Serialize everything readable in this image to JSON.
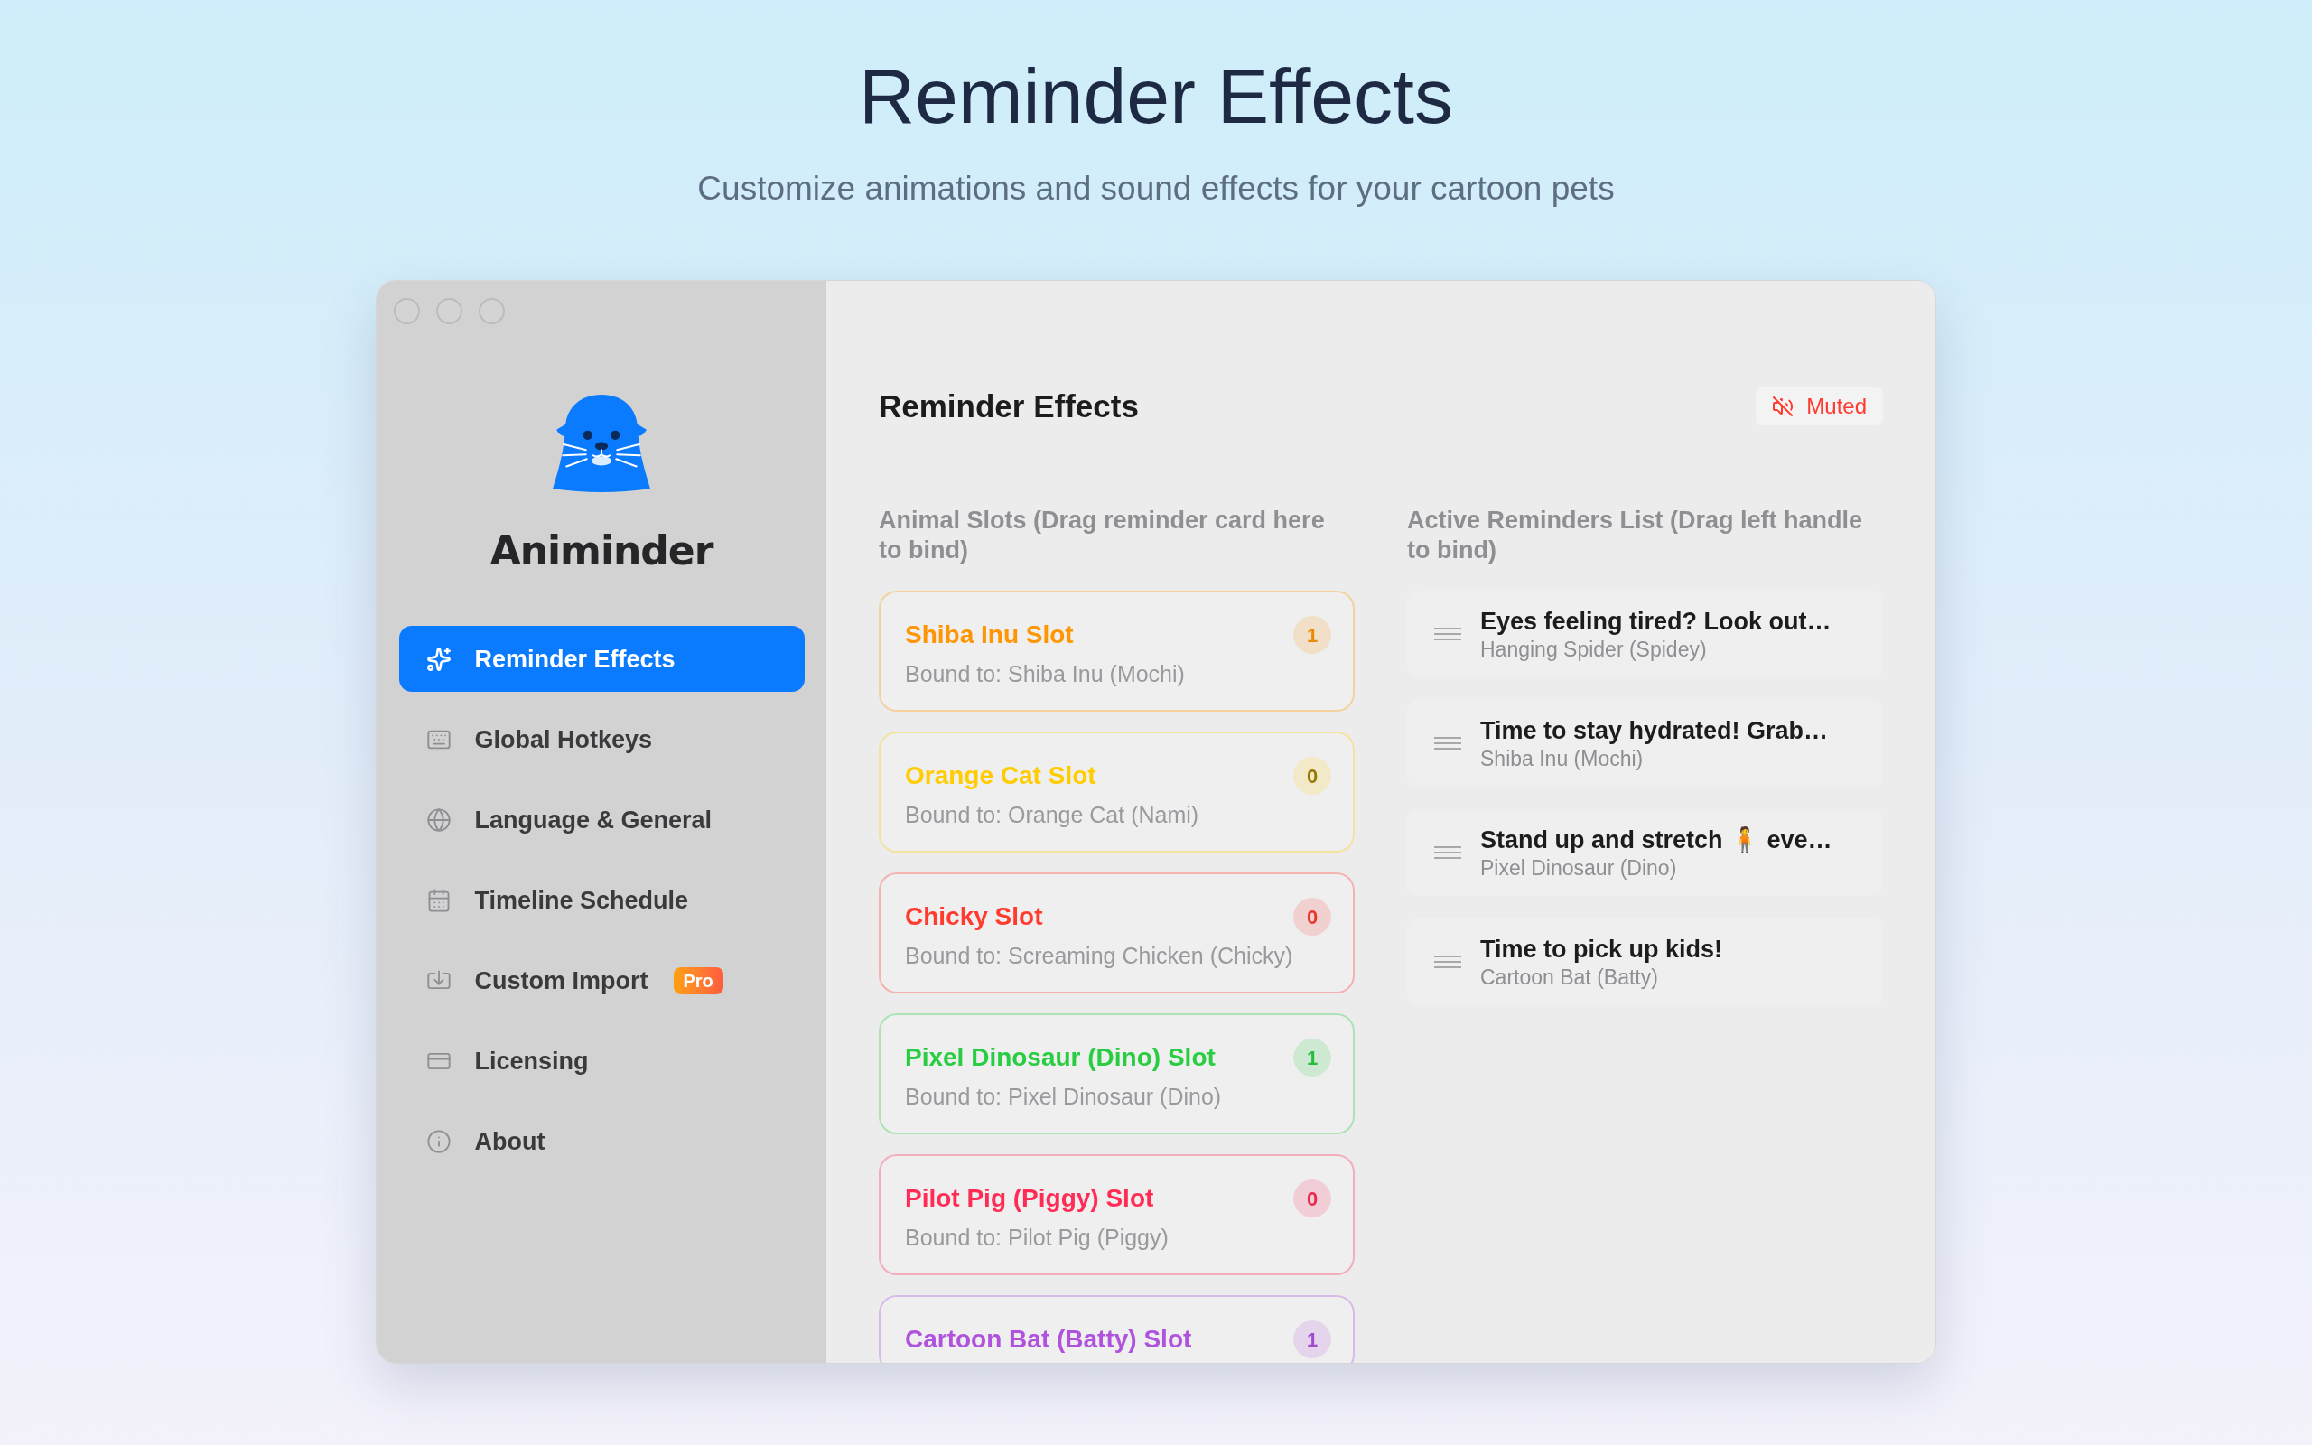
{
  "header": {
    "title": "Reminder Effects",
    "subtitle": "Customize animations and sound effects for your cartoon pets"
  },
  "sidebar": {
    "app_name": "Animinder",
    "items": [
      {
        "label": "Reminder Effects",
        "selected": true
      },
      {
        "label": "Global Hotkeys",
        "selected": false
      },
      {
        "label": "Language & General",
        "selected": false
      },
      {
        "label": "Timeline Schedule",
        "selected": false
      },
      {
        "label": "Custom Import",
        "selected": false,
        "badge": "Pro"
      },
      {
        "label": "Licensing",
        "selected": false
      },
      {
        "label": "About",
        "selected": false
      }
    ]
  },
  "main": {
    "title": "Reminder Effects",
    "sound_button": {
      "label": "Muted",
      "muted": true
    },
    "slots": {
      "heading": "Animal Slots (Drag reminder card here to bind)",
      "items": [
        {
          "name": "Shiba Inu Slot",
          "count": "1",
          "bound_to": "Bound to: Shiba Inu (Mochi)",
          "color": "#ff9500"
        },
        {
          "name": "Orange Cat Slot",
          "count": "0",
          "bound_to": "Bound to: Orange Cat (Nami)",
          "color": "#ffcc00"
        },
        {
          "name": "Chicky Slot",
          "count": "0",
          "bound_to": "Bound to: Screaming Chicken (Chicky)",
          "color": "#ff3b30"
        },
        {
          "name": "Pixel Dinosaur (Dino) Slot",
          "count": "1",
          "bound_to": "Bound to: Pixel Dinosaur (Dino)",
          "color": "#28cd41"
        },
        {
          "name": "Pilot Pig (Piggy) Slot",
          "count": "0",
          "bound_to": "Bound to: Pilot Pig (Piggy)",
          "color": "#ff2d55"
        },
        {
          "name": "Cartoon Bat (Batty) Slot",
          "count": "1",
          "color": "#af52de"
        }
      ]
    },
    "reminders": {
      "heading": "Active Reminders List (Drag left handle to bind)",
      "items": [
        {
          "title": "Eyes feeling tired? Look out…",
          "pet": "Hanging Spider (Spidey)"
        },
        {
          "title": "Time to stay hydrated! Grab…",
          "pet": "Shiba Inu (Mochi)"
        },
        {
          "title": "Stand up and stretch 🧍 eve…",
          "pet": "Pixel Dinosaur (Dino)"
        },
        {
          "title": "Time to pick up kids!",
          "pet": "Cartoon Bat (Batty)"
        }
      ]
    }
  }
}
